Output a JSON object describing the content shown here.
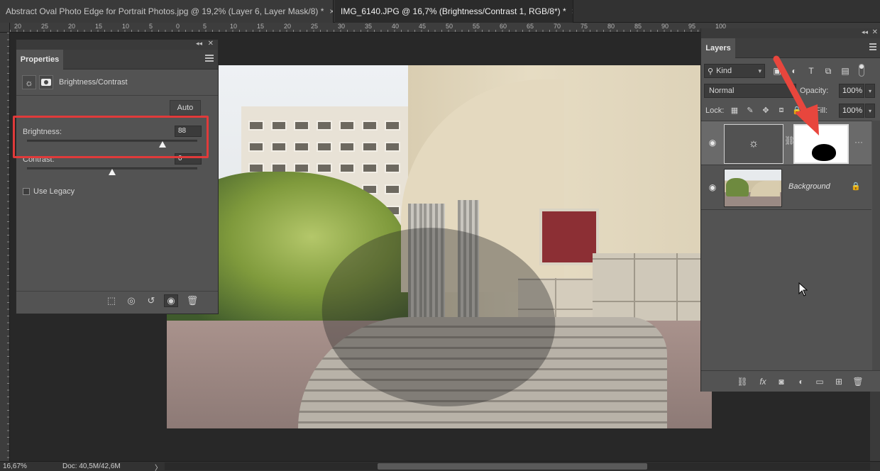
{
  "tabs": [
    {
      "label": "Abstract Oval Photo Edge for Portrait Photos.jpg @ 19,2% (Layer 6, Layer Mask/8) *",
      "close": "×"
    },
    {
      "label": "IMG_6140.JPG @ 16,7% (Brightness/Contrast 1, RGB/8*) *",
      "close": "×"
    }
  ],
  "ruler": {
    "top_numbers": [
      "20",
      "25",
      "20",
      "15",
      "10",
      "5",
      "0",
      "5",
      "10",
      "15",
      "20",
      "25",
      "30",
      "35",
      "40",
      "45",
      "50",
      "55",
      "60",
      "65",
      "70",
      "75",
      "80",
      "85",
      "90",
      "95",
      "100"
    ]
  },
  "properties": {
    "tab_label": "Properties",
    "adjustment_title": "Brightness/Contrast",
    "auto_label": "Auto",
    "brightness_label": "Brightness:",
    "brightness_value": "88",
    "contrast_label": "Contrast:",
    "contrast_value": "0",
    "legacy_label": "Use Legacy",
    "brightness_fraction": 0.794,
    "contrast_fraction": 0.5
  },
  "layers": {
    "tab_label": "Layers",
    "kind_label": "Kind",
    "blend_mode": "Normal",
    "opacity_label": "Opacity:",
    "opacity_value": "100%",
    "lock_label": "Lock:",
    "fill_label": "Fill:",
    "fill_value": "100%",
    "background_layer_name": "Background",
    "more_glyph": "···"
  },
  "status": {
    "zoom": "16,67%",
    "doc": "Doc: 40,5M/42,6M",
    "arrow": "〉"
  },
  "colors": {
    "highlight": "#e03a3a",
    "arrow": "#e8463d",
    "panel_bg": "#535353",
    "app_bg": "#282828"
  },
  "icons": {
    "brightness": "☼",
    "eye": "👁",
    "chain": "🔗",
    "lock": "🔒",
    "trash": "🗑"
  }
}
